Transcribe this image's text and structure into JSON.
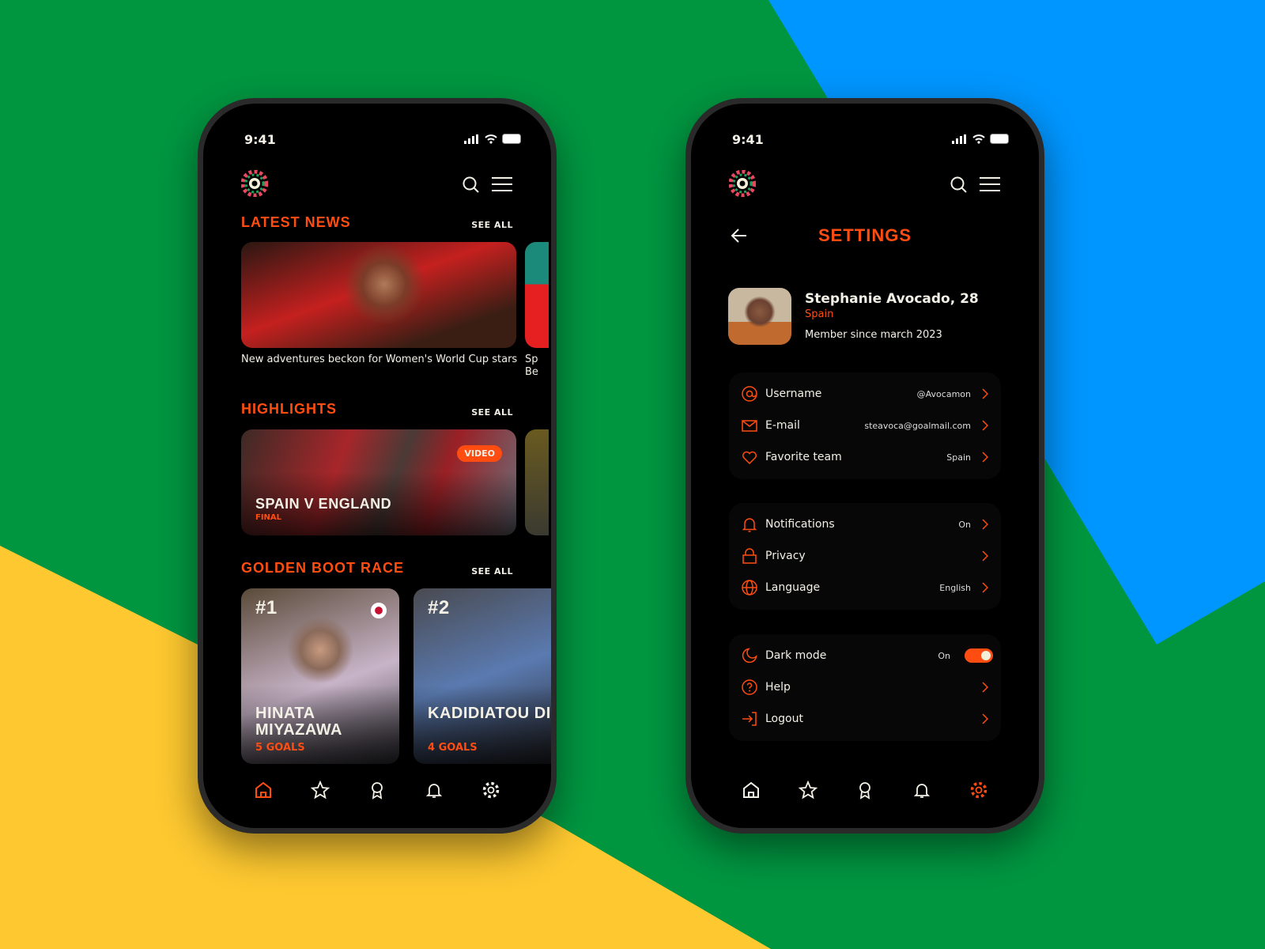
{
  "colors": {
    "accent": "#ff4d12",
    "bg_green": "#009640",
    "bg_blue": "#0096ff",
    "bg_yellow": "#fdc830"
  },
  "status": {
    "time": "9:41"
  },
  "home": {
    "latest_news": {
      "title": "LATEST NEWS",
      "see_all": "SEE ALL",
      "items": [
        {
          "caption": "New adventures beckon for Women's World Cup stars"
        },
        {
          "caption": "Sp Be"
        }
      ]
    },
    "highlights": {
      "title": "HIGHLIGHTS",
      "see_all": "SEE ALL",
      "items": [
        {
          "title": "SPAIN V ENGLAND",
          "subtitle": "FINAL",
          "badge": "VIDEO"
        }
      ]
    },
    "golden_boot": {
      "title": "GOLDEN BOOT RACE",
      "see_all": "SEE ALL",
      "players": [
        {
          "rank": "#1",
          "name": "HINATA MIYAZAWA",
          "goals": "5 GOALS"
        },
        {
          "rank": "#2",
          "name": "KADIDIATOU DIANI",
          "goals": "4 GOALS"
        }
      ]
    }
  },
  "settings": {
    "title": "SETTINGS",
    "profile": {
      "name": "Stephanie Avocado, 28",
      "country": "Spain",
      "member_since": "Member since march 2023"
    },
    "account": [
      {
        "icon": "at-icon",
        "label": "Username",
        "value": "@Avocamon"
      },
      {
        "icon": "mail-icon",
        "label": "E-mail",
        "value": "steavoca@goalmail.com"
      },
      {
        "icon": "heart-icon",
        "label": "Favorite team",
        "value": "Spain"
      }
    ],
    "preferences": [
      {
        "icon": "bell-icon",
        "label": "Notifications",
        "value": "On"
      },
      {
        "icon": "lock-icon",
        "label": "Privacy",
        "value": ""
      },
      {
        "icon": "globe-icon",
        "label": "Language",
        "value": "English"
      }
    ],
    "other": {
      "dark_mode": {
        "label": "Dark mode",
        "value": "On",
        "enabled": true
      },
      "help": "Help",
      "logout": "Logout"
    }
  },
  "nav": [
    "home",
    "favorites",
    "awards",
    "notifications",
    "settings"
  ]
}
